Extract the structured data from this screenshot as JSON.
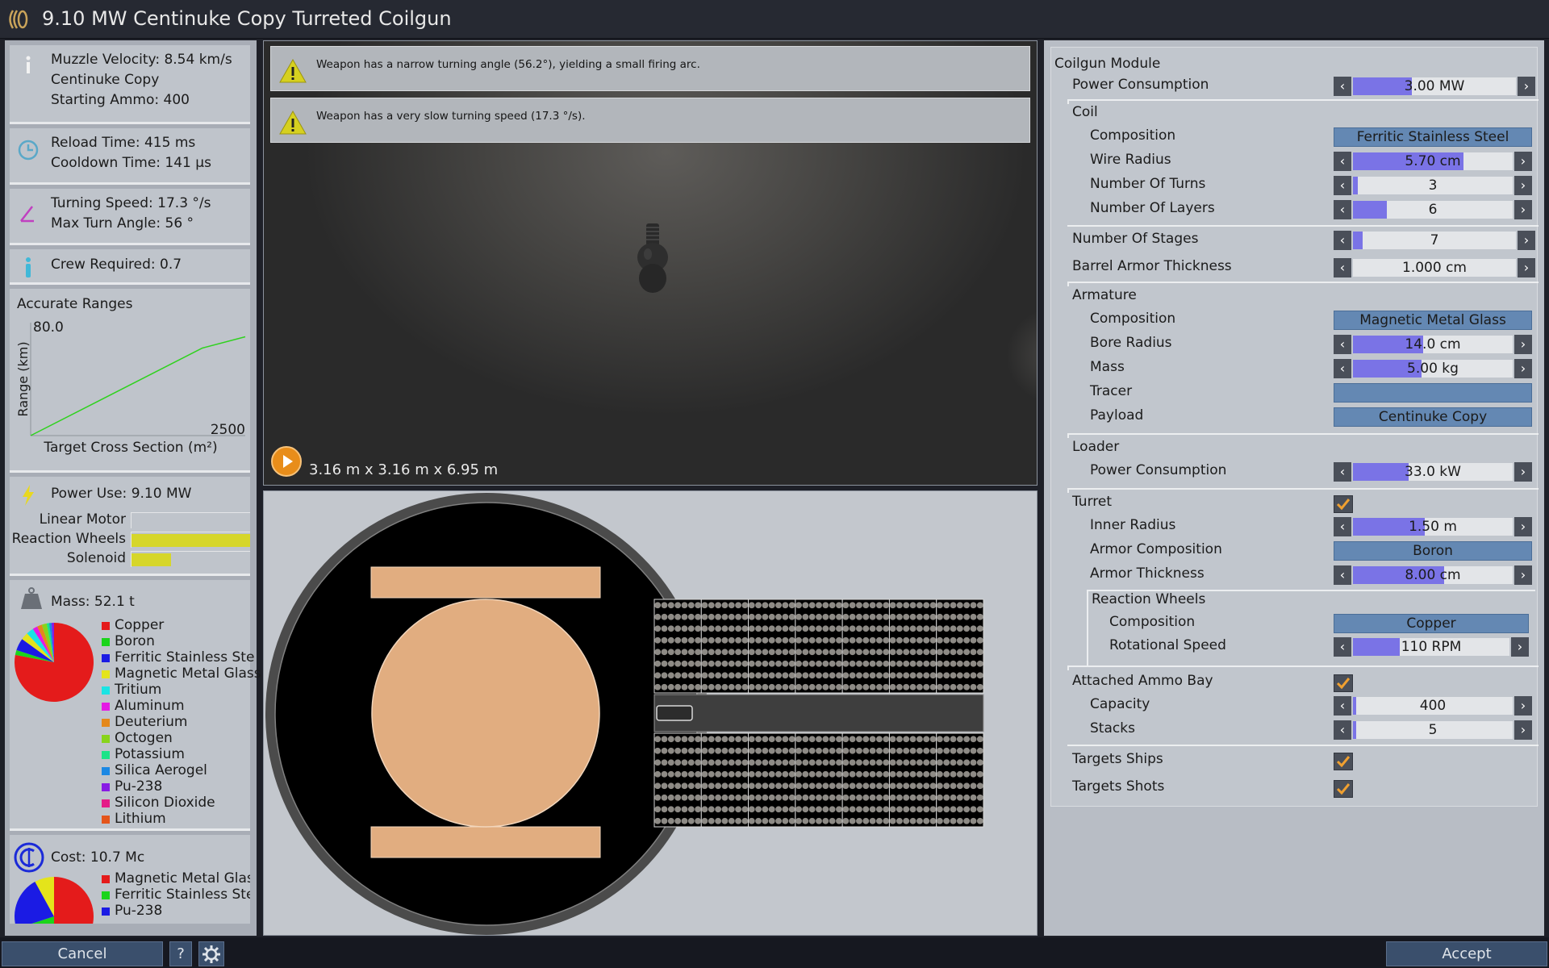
{
  "window": {
    "title": "9.10 MW Centinuke Copy Turreted Coilgun"
  },
  "stats": {
    "muzzle_velocity": "Muzzle Velocity: 8.54 km/s",
    "ammo_name": "Centinuke Copy",
    "starting_ammo": "Starting Ammo: 400",
    "reload_time": "Reload Time: 415 ms",
    "cooldown_time": "Cooldown Time: 141 µs",
    "turning_speed": "Turning Speed: 17.3 °/s",
    "max_turn_angle": "Max Turn Angle: 56 °",
    "crew_required": "Crew Required: 0.7"
  },
  "range_chart": {
    "heading": "Accurate Ranges",
    "chart_data": {
      "type": "line",
      "title": "Accurate Ranges",
      "xlabel": "Target Cross Section (m²)",
      "ylabel": "Range (km)",
      "x_max_label": "2500",
      "y_max_label": "80.0",
      "xlim": [
        0,
        2500
      ],
      "ylim": [
        0,
        80
      ],
      "series": [
        {
          "color": "#2fd21e",
          "x": [
            0,
            2000,
            2500
          ],
          "y": [
            0,
            62,
            70
          ]
        }
      ]
    }
  },
  "power": {
    "label": "Power Use: 9.10 MW",
    "bars": [
      {
        "name": "Linear Motor",
        "fraction": 0.0,
        "color": "#d6d62a"
      },
      {
        "name": "Reaction Wheels",
        "fraction": 1.0,
        "color": "#d6d62a"
      },
      {
        "name": "Solenoid",
        "fraction": 0.33,
        "color": "#d6d62a"
      }
    ]
  },
  "mass": {
    "label": "Mass: 52.1 t",
    "legend": [
      {
        "name": "Copper",
        "color": "#e41b1b"
      },
      {
        "name": "Boron",
        "color": "#1bd41b"
      },
      {
        "name": "Ferritic Stainless Ste",
        "color": "#1b1be4"
      },
      {
        "name": "Magnetic Metal Glass",
        "color": "#e4e41b"
      },
      {
        "name": "Tritium",
        "color": "#1be4e4"
      },
      {
        "name": "Aluminum",
        "color": "#e41be4"
      },
      {
        "name": "Deuterium",
        "color": "#e4881b"
      },
      {
        "name": "Octogen",
        "color": "#88d41b"
      },
      {
        "name": "Potassium",
        "color": "#1be488"
      },
      {
        "name": "Silica Aerogel",
        "color": "#1b88e4"
      },
      {
        "name": "Pu-238",
        "color": "#881be4"
      },
      {
        "name": "Silicon Dioxide",
        "color": "#e41b88"
      },
      {
        "name": "Lithium",
        "color": "#e4551b"
      }
    ]
  },
  "cost": {
    "label": "Cost: 10.7 Mc",
    "legend": [
      {
        "name": "Magnetic Metal Glass",
        "color": "#e41b1b"
      },
      {
        "name": "Ferritic Stainless Ste",
        "color": "#1bd41b"
      },
      {
        "name": "Pu-238",
        "color": "#1b1be4"
      }
    ]
  },
  "viewport": {
    "warnings": [
      "Weapon has a narrow turning angle (56.2°), yielding a small firing arc.",
      "Weapon has a very slow turning speed (17.3 °/s)."
    ],
    "dimensions": "3.16 m x 3.16 m x 6.95 m"
  },
  "module": {
    "title": "Coilgun Module",
    "power_consumption": {
      "label": "Power Consumption",
      "value": "3.00 MW",
      "fraction": 0.36
    },
    "coil": {
      "label": "Coil",
      "composition": {
        "label": "Composition",
        "value": "Ferritic Stainless Steel"
      },
      "wire_radius": {
        "label": "Wire Radius",
        "value": "5.70 cm",
        "fraction": 0.69
      },
      "turns": {
        "label": "Number Of Turns",
        "value": "3",
        "fraction": 0.03
      },
      "layers": {
        "label": "Number Of Layers",
        "value": "6",
        "fraction": 0.21
      }
    },
    "stages": {
      "label": "Number Of Stages",
      "value": "7",
      "fraction": 0.06
    },
    "barrel_armor": {
      "label": "Barrel Armor Thickness",
      "value": "1.000 cm",
      "fraction": 0.0
    },
    "armature": {
      "label": "Armature",
      "composition": {
        "label": "Composition",
        "value": "Magnetic Metal Glass"
      },
      "bore_radius": {
        "label": "Bore Radius",
        "value": "14.0 cm",
        "fraction": 0.44
      },
      "mass": {
        "label": "Mass",
        "value": "5.00 kg",
        "fraction": 0.43
      },
      "tracer": {
        "label": "Tracer",
        "value": ""
      },
      "payload": {
        "label": "Payload",
        "value": "Centinuke Copy"
      }
    },
    "loader": {
      "label": "Loader",
      "power_consumption": {
        "label": "Power Consumption",
        "value": "33.0 kW",
        "fraction": 0.35
      }
    },
    "turret": {
      "label": "Turret",
      "enabled": true,
      "inner_radius": {
        "label": "Inner Radius",
        "value": "1.50 m",
        "fraction": 0.45
      },
      "armor_composition": {
        "label": "Armor Composition",
        "value": "Boron"
      },
      "armor_thickness": {
        "label": "Armor Thickness",
        "value": "8.00 cm",
        "fraction": 0.57
      },
      "reaction_wheels": {
        "label": "Reaction Wheels",
        "composition": {
          "label": "Composition",
          "value": "Copper"
        },
        "rotational_speed": {
          "label": "Rotational Speed",
          "value": "110 RPM",
          "fraction": 0.3
        }
      }
    },
    "ammo_bay": {
      "label": "Attached Ammo Bay",
      "enabled": true,
      "capacity": {
        "label": "Capacity",
        "value": "400",
        "fraction": 0.02
      },
      "stacks": {
        "label": "Stacks",
        "value": "5",
        "fraction": 0.02
      }
    },
    "targets_ships": {
      "label": "Targets Ships",
      "enabled": true
    },
    "targets_shots": {
      "label": "Targets Shots",
      "enabled": true
    }
  },
  "bottom": {
    "cancel": "Cancel",
    "help": "?",
    "accept": "Accept"
  }
}
